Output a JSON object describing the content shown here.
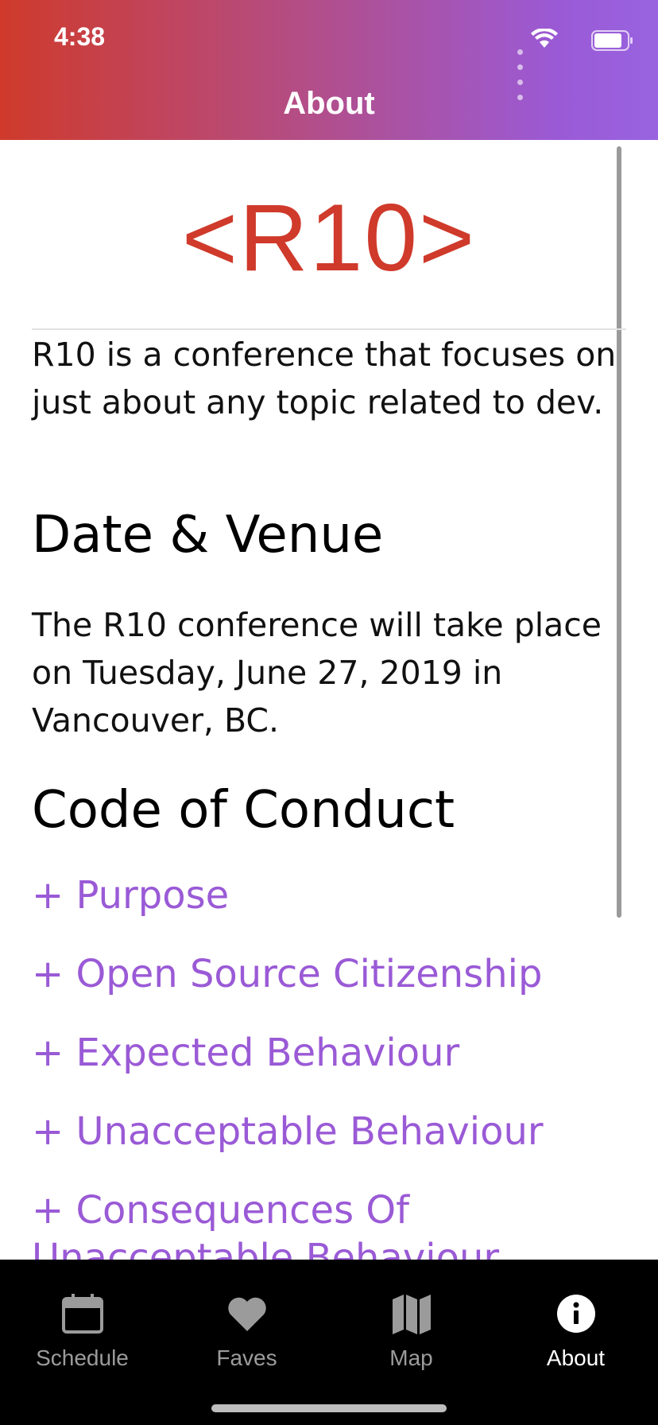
{
  "status_bar": {
    "time": "4:38"
  },
  "header": {
    "title": "About"
  },
  "logo": {
    "text": "<R10>"
  },
  "intro": {
    "text": "R10 is a conference that focuses on just about any topic related to dev."
  },
  "date_venue": {
    "heading": "Date & Venue",
    "text": "The R10 conference will take place on Tuesday, June 27, 2019 in Vancouver, BC."
  },
  "code_of_conduct": {
    "heading": "Code of Conduct",
    "items": [
      {
        "label": "+ Purpose"
      },
      {
        "label": "+ Open Source Citizenship"
      },
      {
        "label": "+ Expected Behaviour"
      },
      {
        "label": "+ Unacceptable Behaviour"
      },
      {
        "label": "+ Consequences Of Unacceptable Behaviour"
      }
    ]
  },
  "tabbar": {
    "tabs": [
      {
        "label": "Schedule",
        "icon": "calendar-icon"
      },
      {
        "label": "Faves",
        "icon": "heart-icon"
      },
      {
        "label": "Map",
        "icon": "map-icon"
      },
      {
        "label": "About",
        "icon": "info-icon",
        "active": true
      }
    ]
  },
  "colors": {
    "brand_red": "#cf3a2b",
    "brand_purple": "#9a5ad6",
    "tab_inactive": "#9b9b9b",
    "tab_active": "#ffffff"
  }
}
